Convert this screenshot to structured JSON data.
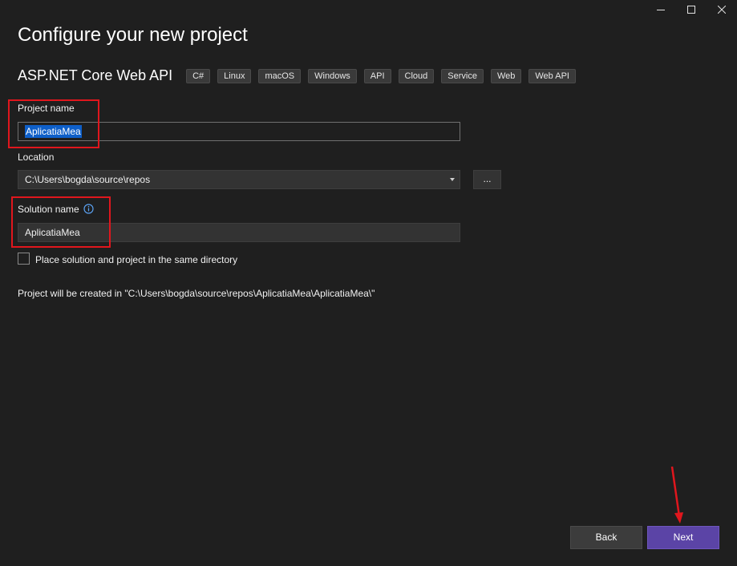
{
  "dialog": {
    "title": "Configure your new project"
  },
  "template": {
    "name": "ASP.NET Core Web API",
    "tags": [
      "C#",
      "Linux",
      "macOS",
      "Windows",
      "API",
      "Cloud",
      "Service",
      "Web",
      "Web API"
    ]
  },
  "project_name": {
    "label": "Project name",
    "value": "AplicatiaMea",
    "selected": true
  },
  "location": {
    "label": "Location",
    "value": "C:\\Users\\bogda\\source\\repos",
    "browse_label": "..."
  },
  "solution_name": {
    "label": "Solution name",
    "value": "AplicatiaMea",
    "info_icon": "info-icon"
  },
  "same_directory": {
    "label": "Place solution and project in the same directory",
    "checked": false
  },
  "summary": {
    "text": "Project will be created in \"C:\\Users\\bogda\\source\\repos\\AplicatiaMea\\AplicatiaMea\\\""
  },
  "footer": {
    "back_label": "Back",
    "next_label": "Next"
  },
  "colors": {
    "background": "#1f1f1f",
    "accent": "#5b44a6",
    "annotation_red": "#e0161d",
    "selection": "#0e5fc9"
  }
}
